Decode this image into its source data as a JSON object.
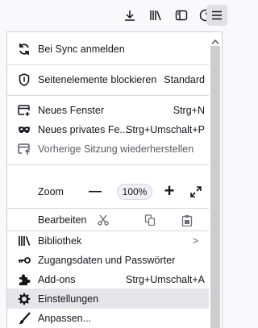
{
  "menu": {
    "sync": "Bei Sync anmelden",
    "block_elements": "Seitenelemente blockieren",
    "block_elements_value": "Standard",
    "new_window": "Neues Fenster",
    "new_window_shortcut": "Strg+N",
    "private_window": "Neues privates Fe...",
    "private_window_shortcut": "Strg+Umschalt+P",
    "restore_session": "Vorherige Sitzung wiederherstellen",
    "zoom_label": "Zoom",
    "zoom_minus": "—",
    "zoom_value": "100%",
    "zoom_plus": "+",
    "edit_label": "Bearbeiten",
    "library": "Bibliothek",
    "library_arrow": ">",
    "passwords": "Zugangsdaten und Passwörter",
    "addons": "Add-ons",
    "addons_shortcut": "Strg+Umschalt+A",
    "settings": "Einstellungen",
    "customize": "Anpassen..."
  },
  "icons": {
    "toolbar": [
      "download-icon",
      "library-icon",
      "sidebar-icon",
      "extensions-icon",
      "hamburger-menu-icon"
    ],
    "sync": "sync-icon",
    "block": "shield-icon",
    "new_window": "new-window-icon",
    "private": "private-mask-icon",
    "restore": "restore-session-icon",
    "fullscreen": "fullscreen-icon",
    "cut": "cut-icon",
    "copy": "copy-icon",
    "paste": "paste-icon",
    "library": "library-icon",
    "passwords": "key-icon",
    "addons": "puzzle-icon",
    "settings": "gear-icon",
    "customize": "brush-icon"
  },
  "colors": {
    "menu_bg": "#ffffff",
    "toolbar_bg": "#f9f9fb",
    "hover_bg": "#e6e6ea",
    "text": "#15141a",
    "accent_blue": "#0061e0",
    "scroll_thumb": "#cdcdcd"
  }
}
